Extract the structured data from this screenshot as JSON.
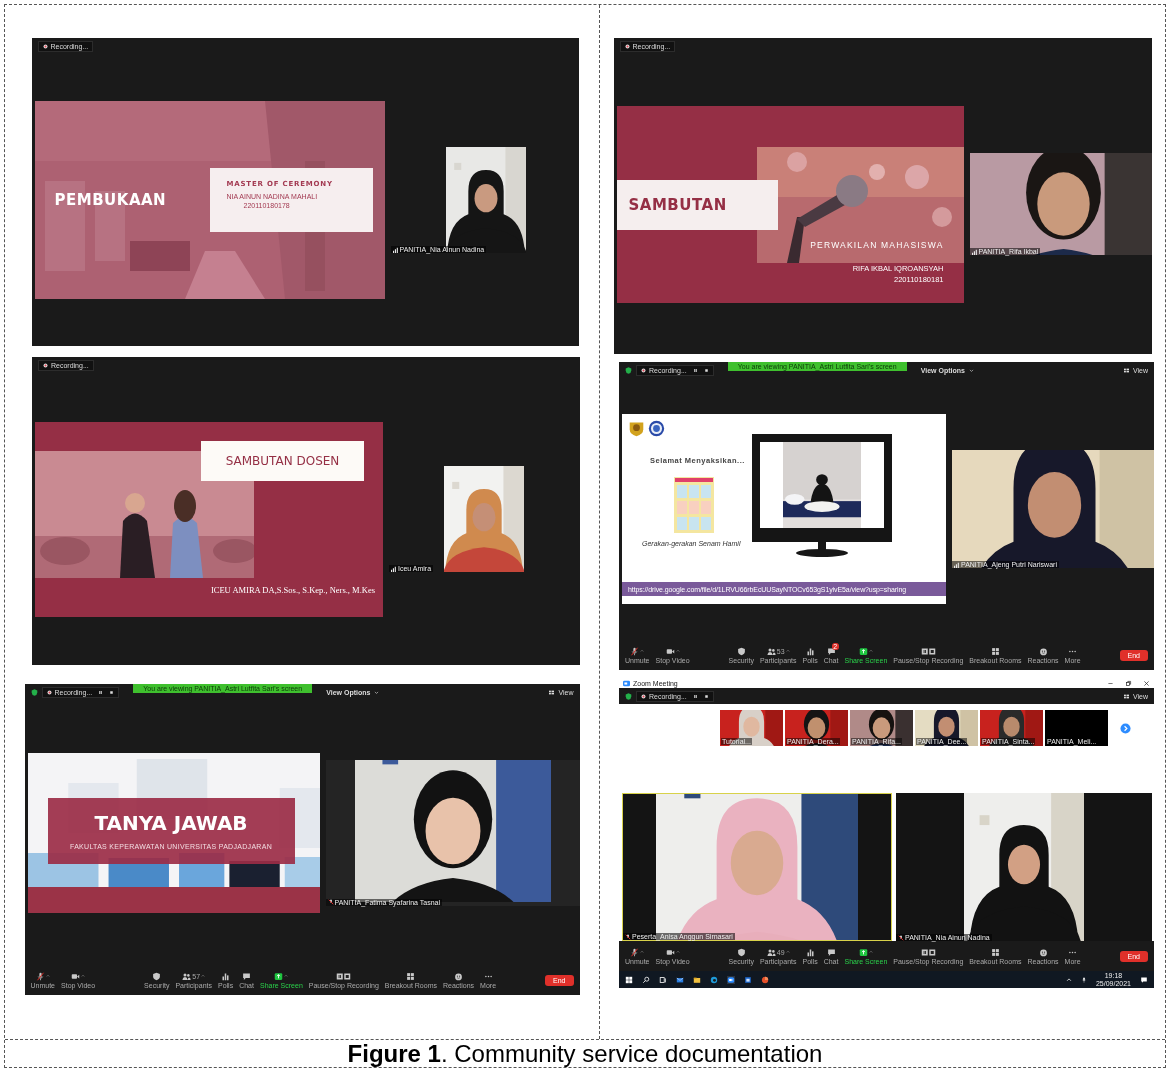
{
  "panels": [
    {
      "top_bar": {
        "recording": "Recording...",
        "recording_controls": false
      },
      "slide": {
        "kind": "opening",
        "title": "PEMBUKAAN",
        "heading": "MASTER OF CEREMONY",
        "lines": [
          "NIA AINUN NADINA MAHALI",
          "220110180178"
        ]
      },
      "videos": [
        {
          "name": "PANITIA_Nia Ainun Nadina",
          "muted": false
        }
      ]
    },
    {
      "top_bar": {
        "recording": "Recording...",
        "recording_controls": false
      },
      "slide": {
        "kind": "speech",
        "title": "SAMBUTAN",
        "heading": "PERWAKILAN MAHASISWA",
        "lines": [
          "RIFA IKBAL IQROANSYAH",
          "220110180181"
        ]
      },
      "videos": [
        {
          "name": "PANITIA_Rifa Ikbal",
          "muted": false
        }
      ]
    },
    {
      "top_bar": {
        "recording": "Recording...",
        "recording_controls": false
      },
      "slide": {
        "kind": "lecturer",
        "title": "SAMBUTAN DOSEN",
        "lines": [
          "ICEU AMIRA DA,S.Sos., S.Kep., Ners., M.Kes"
        ]
      },
      "videos": [
        {
          "name": "Iceu Amira",
          "muted": false
        }
      ]
    },
    {
      "top_bar": {
        "recording": "Recording...",
        "recording_controls": true,
        "banner": "You are viewing PANITIA_Astri Lutfita Sari's screen",
        "view_options": "View Options",
        "view": "View"
      },
      "slide": {
        "kind": "webinar",
        "title": "Selamat Menyaksikan...",
        "caption": "Gerakan-gerakan Senam Hamil",
        "url": "https://drive.google.com/file/d/1LRVU66rbEcUUSayNTOCv653gS1yivE5a/view?usp=sharing"
      },
      "videos": [
        {
          "name": "PANITIA_Ajeng Putri Nariswari",
          "muted": false
        }
      ],
      "toolbar": {
        "items": [
          {
            "kind": "mic",
            "label": "Unmute"
          },
          {
            "kind": "video",
            "label": "Stop Video"
          },
          {
            "kind": "security",
            "label": "Security"
          },
          {
            "kind": "participants",
            "label": "Participants",
            "count": "53"
          },
          {
            "kind": "polls",
            "label": "Polls"
          },
          {
            "kind": "chat",
            "label": "Chat",
            "badge": "2"
          },
          {
            "kind": "share",
            "label": "Share Screen"
          },
          {
            "kind": "record",
            "label": "Pause/Stop Recording"
          },
          {
            "kind": "breakout",
            "label": "Breakout Rooms"
          },
          {
            "kind": "reactions",
            "label": "Reactions"
          },
          {
            "kind": "more",
            "label": "More"
          }
        ],
        "end": "End"
      }
    },
    {
      "top_bar": {
        "recording": "Recording...",
        "recording_controls": true,
        "banner": "You are viewing PANITIA_Astri Lutfita Sari's screen",
        "view_options": "View Options",
        "view": "View"
      },
      "slide": {
        "kind": "questions",
        "title": "TANYA JAWAB",
        "heading": "FAKULTAS KEPERAWATAN UNIVERSITAS PADJADJARAN"
      },
      "videos": [
        {
          "name": "PANITIA_Fatima Syafarina Tasnal",
          "muted": true
        }
      ],
      "toolbar": {
        "items": [
          {
            "kind": "mic",
            "label": "Unmute"
          },
          {
            "kind": "video",
            "label": "Stop Video"
          },
          {
            "kind": "security",
            "label": "Security"
          },
          {
            "kind": "participants",
            "label": "Participants",
            "count": "57"
          },
          {
            "kind": "polls",
            "label": "Polls"
          },
          {
            "kind": "chat",
            "label": "Chat"
          },
          {
            "kind": "share",
            "label": "Share Screen"
          },
          {
            "kind": "record",
            "label": "Pause/Stop Recording"
          },
          {
            "kind": "breakout",
            "label": "Breakout Rooms"
          },
          {
            "kind": "reactions",
            "label": "Reactions"
          },
          {
            "kind": "more",
            "label": "More"
          }
        ],
        "end": "End"
      }
    },
    {
      "title_bar": {
        "title": "Zoom Meeting"
      },
      "top_bar": {
        "recording": "Recording...",
        "recording_controls": true,
        "view": "View"
      },
      "thumbnails": [
        {
          "name": "Tutorial..."
        },
        {
          "name": "PANITIA_Dera..."
        },
        {
          "name": "PANITIA_Rifa..."
        },
        {
          "name": "PANITIA_Dee..."
        },
        {
          "name": "PANITIA_Sinta..."
        },
        {
          "name": "PANITIA_Meli..."
        }
      ],
      "videos": [
        {
          "name": "Peserta_Anisa Anggun Sirnasari",
          "muted": true,
          "selected": true
        },
        {
          "name": "PANITIA_Nia Ainun Nadina",
          "muted": true,
          "selected": false
        }
      ],
      "toolbar": {
        "items": [
          {
            "kind": "mic",
            "label": "Unmute"
          },
          {
            "kind": "video",
            "label": "Stop Video"
          },
          {
            "kind": "security",
            "label": "Security"
          },
          {
            "kind": "participants",
            "label": "Participants",
            "count": "49"
          },
          {
            "kind": "polls",
            "label": "Polls"
          },
          {
            "kind": "chat",
            "label": "Chat"
          },
          {
            "kind": "share",
            "label": "Share Screen"
          },
          {
            "kind": "record",
            "label": "Pause/Stop Recording"
          },
          {
            "kind": "breakout",
            "label": "Breakout Rooms"
          },
          {
            "kind": "reactions",
            "label": "Reactions"
          },
          {
            "kind": "more",
            "label": "More"
          }
        ],
        "end": "End"
      },
      "taskbar": {
        "time": "19:18",
        "date": "25/09/2021"
      }
    }
  ],
  "caption": "**Figure 1**. Community service documentation"
}
